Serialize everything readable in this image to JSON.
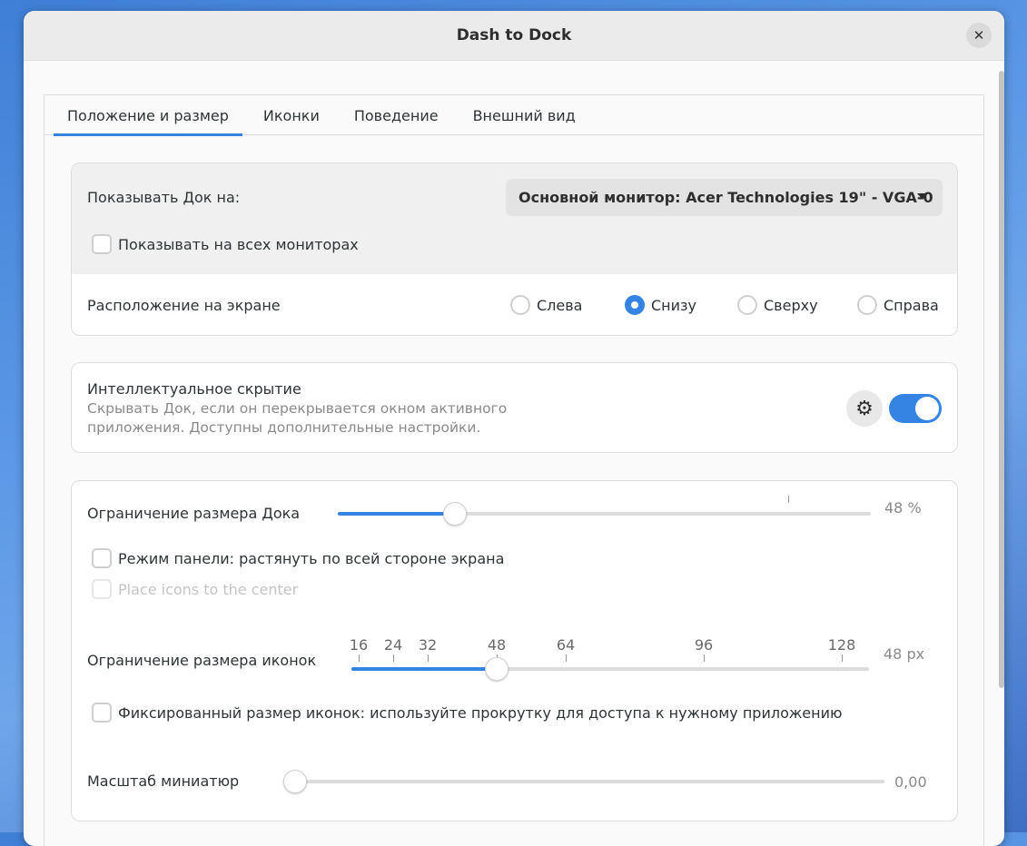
{
  "window": {
    "title": "Dash to Dock"
  },
  "tabs": [
    {
      "label": "Положение и размер",
      "active": true
    },
    {
      "label": "Иконки",
      "active": false
    },
    {
      "label": "Поведение",
      "active": false
    },
    {
      "label": "Внешний вид",
      "active": false
    }
  ],
  "monitor": {
    "label": "Показывать Док на:",
    "selected": "Основной монитор: Acer Technologies 19\" - VGA-0",
    "all_monitors_label": "Показывать на всех мониторах",
    "all_monitors_checked": false
  },
  "position": {
    "label": "Расположение на экране",
    "options": [
      {
        "label": "Слева",
        "selected": false
      },
      {
        "label": "Снизу",
        "selected": true
      },
      {
        "label": "Сверху",
        "selected": false
      },
      {
        "label": "Справа",
        "selected": false
      }
    ]
  },
  "intellihide": {
    "title": "Интеллектуальное скрытие",
    "subtitle_line1": "Скрывать Док, если он перекрывается окном активного",
    "subtitle_line2": "приложения. Доступны дополнительные настройки.",
    "enabled": true,
    "settings_icon": "gear-icon"
  },
  "dock_size": {
    "label": "Ограничение размера Дока",
    "value": 48,
    "value_text": "48 %",
    "panel_mode_label": "Режим панели: растянуть по всей стороне экрана",
    "panel_mode_checked": false,
    "center_label": "Place icons to the center",
    "center_enabled": false
  },
  "icon_size": {
    "label": "Ограничение размера иконок",
    "value": 48,
    "value_text": "48 px",
    "marks": [
      "16",
      "24",
      "32",
      "48",
      "64",
      "96",
      "128"
    ],
    "fixed_label": "Фиксированный размер иконок: используйте прокрутку для доступа к нужному приложению",
    "fixed_checked": false
  },
  "preview_scale": {
    "label": "Масштаб миниатюр",
    "value": 0,
    "value_text": "0,00"
  },
  "colors": {
    "accent": "#3584e4"
  }
}
